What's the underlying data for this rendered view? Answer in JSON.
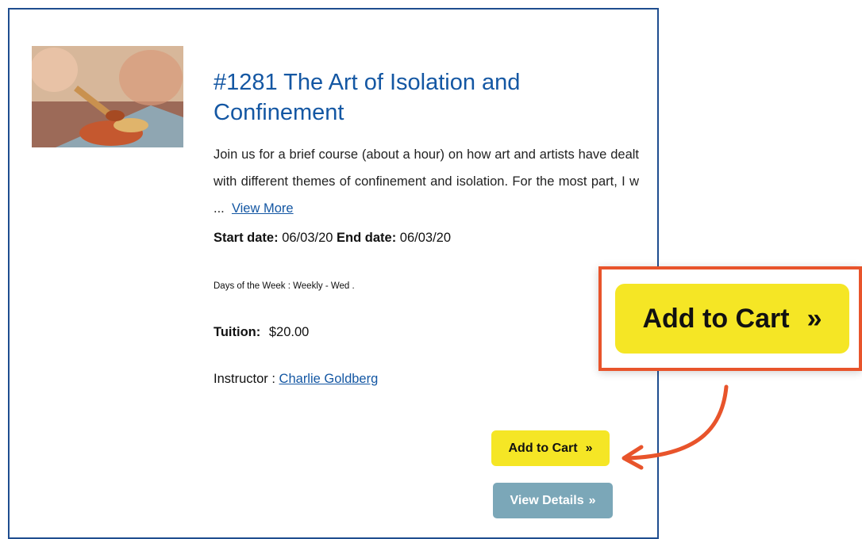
{
  "course": {
    "title": "#1281 The Art of Isolation and Confinement",
    "description": "Join us for a brief course (about a hour) on how art and artists have dealt with different themes of confinement and isolation. For the most part, I w ...",
    "view_more_label": "View More",
    "start_date_label": "Start date:",
    "start_date": "06/03/20",
    "end_date_label": "End date:",
    "end_date": "06/03/20",
    "days_of_week": "Days of the Week : Weekly - Wed .",
    "tuition_label": "Tuition:",
    "tuition": "$20.00",
    "instructor_label": "Instructor :",
    "instructor_name": "Charlie Goldberg"
  },
  "buttons": {
    "add_to_cart": "Add to Cart",
    "view_details": "View Details",
    "chevron": "»"
  },
  "callout": {
    "label": "Add to Cart",
    "chevron": "»"
  },
  "colors": {
    "card_border": "#1f4d8f",
    "title": "#1457a3",
    "cart_button": "#f5e625",
    "details_button": "#7ba7b8",
    "callout_border": "#e8542b"
  },
  "icons": {
    "course_image": "painting-brush-image",
    "arrow": "curved-arrow-icon"
  }
}
